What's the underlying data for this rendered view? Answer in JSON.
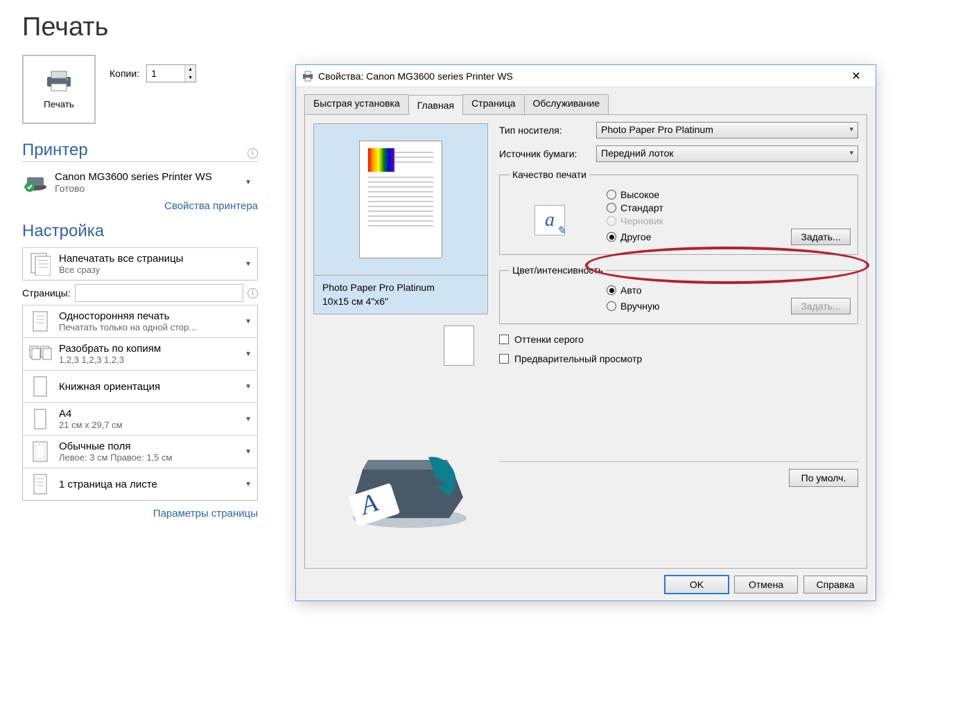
{
  "backstage": {
    "title": "Печать",
    "printButton": "Печать",
    "copiesLabel": "Копии:",
    "copiesValue": "1",
    "printerSection": "Принтер",
    "printerName": "Canon MG3600 series Printer WS",
    "printerStatus": "Готово",
    "printerPropsLink": "Свойства принтера",
    "settingsSection": "Настройка",
    "settings": [
      {
        "title": "Напечатать все страницы",
        "subtitle": "Все сразу"
      }
    ],
    "pagesLabel": "Страницы:",
    "pagesValue": "",
    "settings2": [
      {
        "title": "Односторонняя печать",
        "subtitle": "Печатать только на одной стор..."
      },
      {
        "title": "Разобрать по копиям",
        "subtitle": "1,2,3    1,2,3    1,2,3"
      },
      {
        "title": "Книжная ориентация",
        "subtitle": ""
      },
      {
        "title": "А4",
        "subtitle": "21 см x 29,7 см"
      },
      {
        "title": "Обычные поля",
        "subtitle": "Левое:  3 см    Правое:  1,5 см"
      },
      {
        "title": "1 страница на листе",
        "subtitle": ""
      }
    ],
    "pageSetupLink": "Параметры страницы"
  },
  "dialog": {
    "title": "Свойства: Canon MG3600 series Printer WS",
    "tabs": [
      "Быстрая установка",
      "Главная",
      "Страница",
      "Обслуживание"
    ],
    "activeTab": 1,
    "mediaTypeLabel": "Тип носителя:",
    "mediaTypeValue": "Photo Paper Pro Platinum",
    "paperSourceLabel": "Источник бумаги:",
    "paperSourceValue": "Передний лоток",
    "preview": {
      "line1": "Photo Paper Pro Platinum",
      "line2": "10x15 см 4\"x6\""
    },
    "quality": {
      "legend": "Качество печати",
      "options": [
        "Высокое",
        "Стандарт",
        "Черновик",
        "Другое"
      ],
      "selected": 3,
      "disabled": [
        2
      ],
      "setButton": "Задать..."
    },
    "color": {
      "legend": "Цвет/интенсивность",
      "options": [
        "Авто",
        "Вручную"
      ],
      "selected": 0,
      "setButton": "Задать..."
    },
    "grayscale": "Оттенки серого",
    "previewCheck": "Предварительный просмотр",
    "defaultsButton": "По умолч.",
    "footer": {
      "ok": "OK",
      "cancel": "Отмена",
      "help": "Справка"
    }
  }
}
